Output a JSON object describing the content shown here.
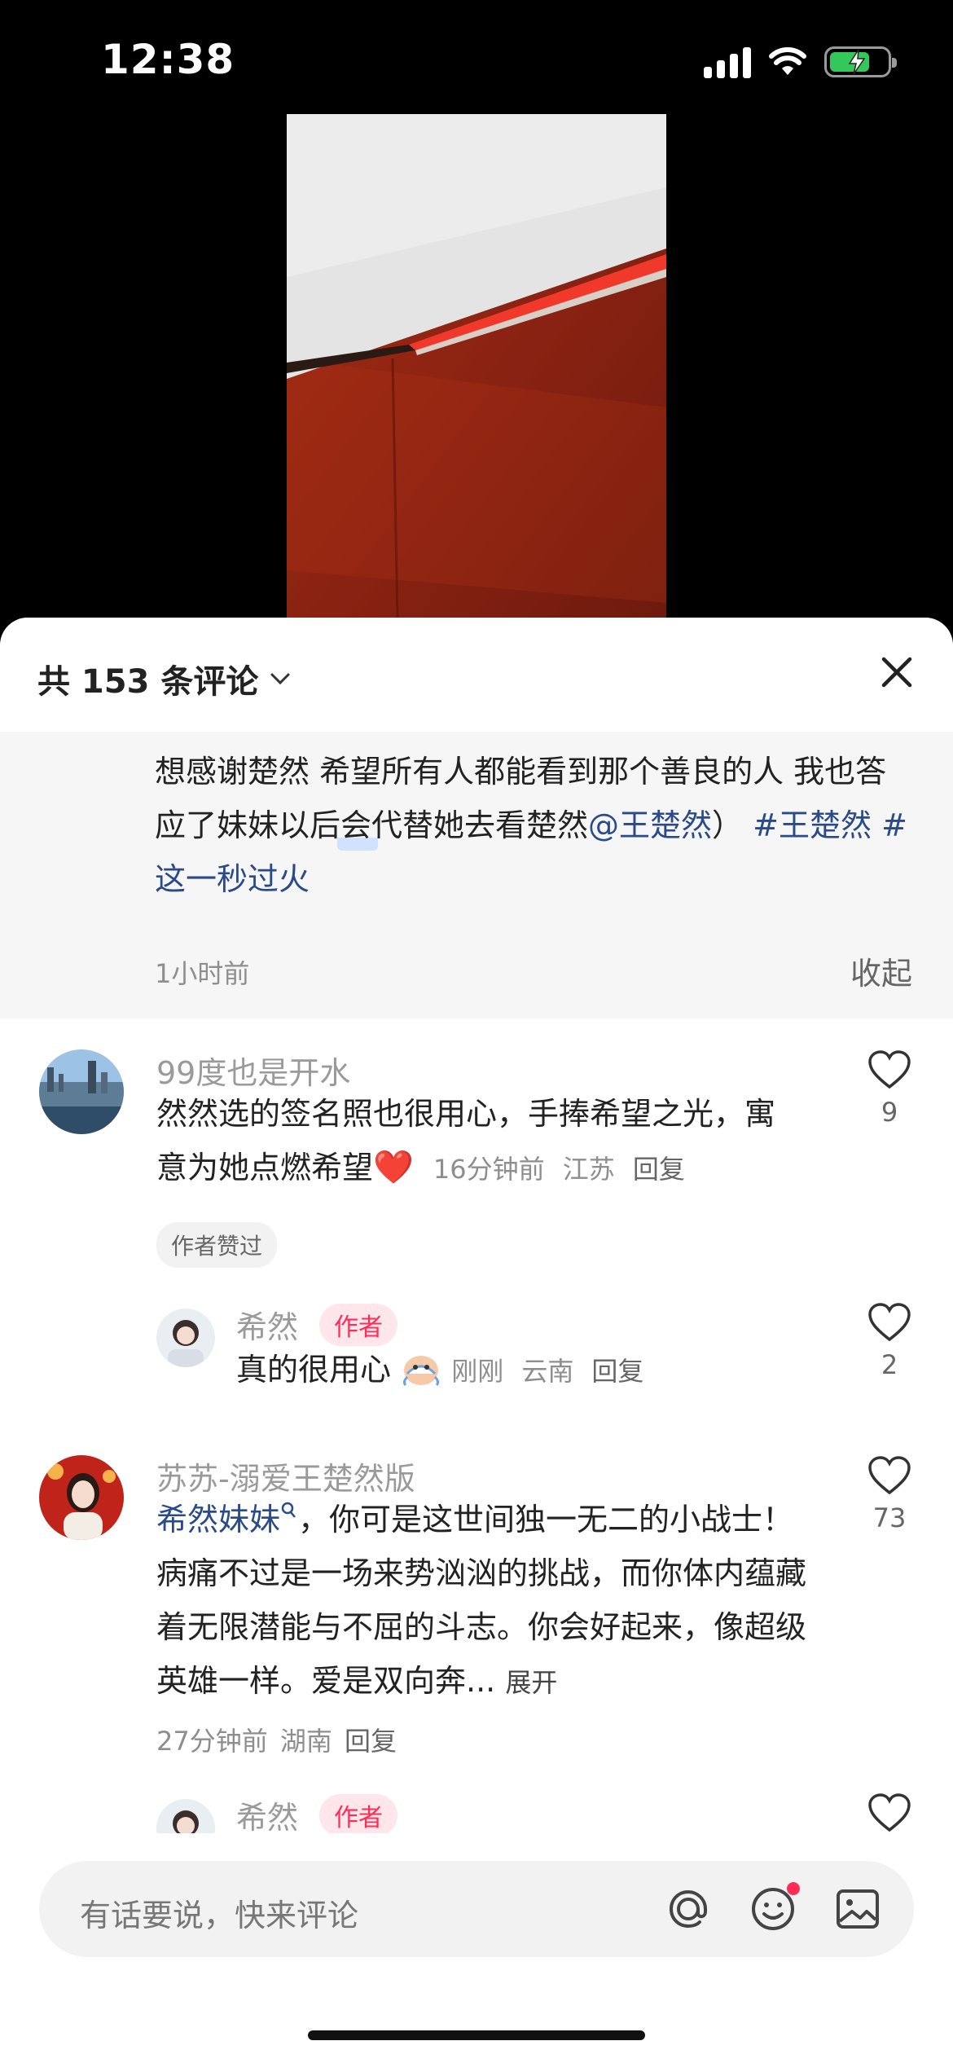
{
  "status_bar": {
    "time": "12:38"
  },
  "sheet": {
    "title": "共 153 条评论",
    "close_icon": "close-icon"
  },
  "expanded_comment": {
    "text_part1": "想感谢楚然 希望所有人都能看到那个善良的人 我也答应了妹妹以后会代替她去看楚然",
    "mention": "@王楚然",
    "text_part2": "）",
    "hashtag1": "#王楚然",
    "hashtag2": "#这一秒过火",
    "time": "1小时前",
    "collapse_label": "收起"
  },
  "comments": [
    {
      "name": "99度也是开水",
      "body": "然然选的签名照也很用心，手捧希望之光，寓意为她点燃希望",
      "emoji": "❤️",
      "time": "16分钟前",
      "location": "江苏",
      "reply": "回复",
      "likes": "9",
      "liked_tag": "作者赞过",
      "reply_item": {
        "name": "希然",
        "badge": "作者",
        "body": "真的很用心",
        "time": "刚刚",
        "location": "云南",
        "reply": "回复",
        "likes": "2"
      }
    },
    {
      "name": "苏苏-溺爱王楚然版",
      "mention": "希然妹妹",
      "body": "，你可是这世间独一无二的小战士！病痛不过是一场来势汹汹的挑战，而你体内蕴藏着无限潜能与不屈的斗志。你会好起来，像超级英雄一样。爱是双向奔...",
      "expand": "展开",
      "time": "27分钟前",
      "location": "湖南",
      "reply": "回复",
      "likes": "73",
      "reply_item": {
        "name": "希然",
        "badge": "作者"
      }
    }
  ],
  "input": {
    "placeholder": "有话要说，快来评论",
    "icons": [
      "at-icon",
      "emoji-icon",
      "image-icon"
    ]
  },
  "colors": {
    "link": "#2b4a8a",
    "author_badge": "#ff2d55",
    "battery_fill": "#34c759"
  }
}
